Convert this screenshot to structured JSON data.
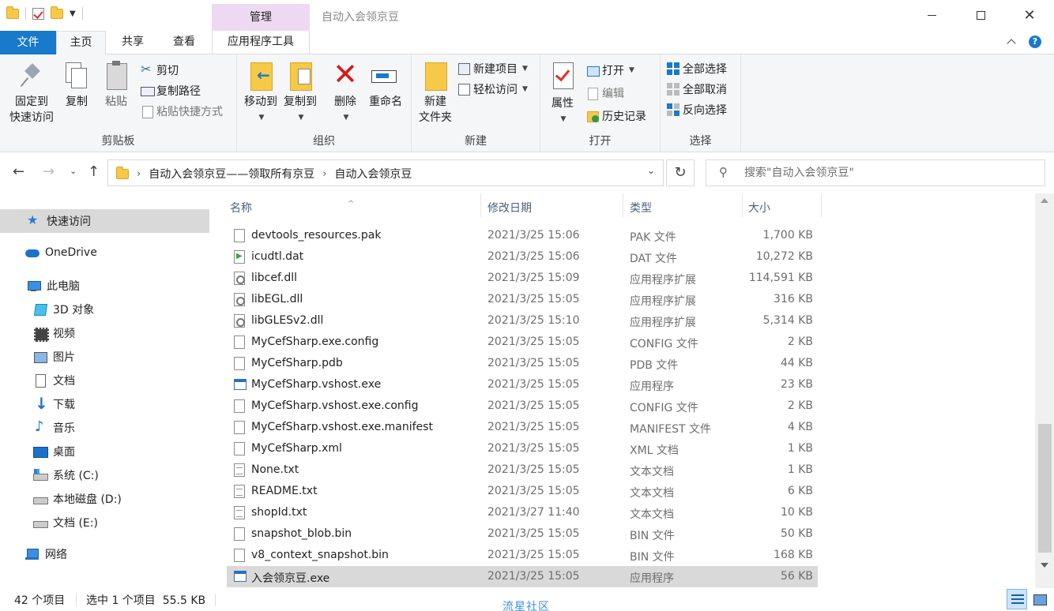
{
  "window": {
    "title": "自动入会领京豆",
    "manage_tab": "管理"
  },
  "ribbon_tabs": {
    "file": "文件",
    "home": "主页",
    "share": "共享",
    "view": "查看",
    "app_tools": "应用程序工具"
  },
  "ribbon": {
    "clipboard": {
      "label": "剪贴板",
      "pin": "固定到\n快速访问",
      "pin_line1": "固定到",
      "pin_line2": "快速访问",
      "copy": "复制",
      "paste": "粘贴",
      "cut": "剪切",
      "copy_path": "复制路径",
      "paste_shortcut": "粘贴快捷方式"
    },
    "organize": {
      "label": "组织",
      "move_to": "移动到",
      "copy_to": "复制到",
      "delete": "删除",
      "rename": "重命名"
    },
    "new": {
      "label": "新建",
      "new_folder_line1": "新建",
      "new_folder_line2": "文件夹",
      "new_item": "新建项目",
      "easy_access": "轻松访问"
    },
    "open": {
      "label": "打开",
      "properties": "属性",
      "open": "打开",
      "edit": "编辑",
      "history": "历史记录"
    },
    "select": {
      "label": "选择",
      "select_all": "全部选择",
      "select_none": "全部取消",
      "invert": "反向选择"
    }
  },
  "address": {
    "crumbs": [
      "自动入会领京豆——领取所有京豆",
      "自动入会领京豆"
    ]
  },
  "search": {
    "placeholder": "搜索\"自动入会领京豆\""
  },
  "nav_pane": {
    "quick_access": "快速访问",
    "onedrive": "OneDrive",
    "this_pc": "此电脑",
    "objects3d": "3D 对象",
    "videos": "视频",
    "pictures": "图片",
    "documents": "文档",
    "downloads": "下载",
    "music": "音乐",
    "desktop": "桌面",
    "drive_c": "系统 (C:)",
    "drive_d": "本地磁盘 (D:)",
    "drive_e": "文档 (E:)",
    "network": "网络"
  },
  "columns": {
    "name": "名称",
    "modified": "修改日期",
    "type": "类型",
    "size": "大小"
  },
  "files": [
    {
      "name": "devtools_resources.pak",
      "date": "2021/3/25 15:06",
      "type": "PAK 文件",
      "size": "1,700 KB",
      "icon": "blank-file-icon"
    },
    {
      "name": "icudtl.dat",
      "date": "2021/3/25 15:06",
      "type": "DAT 文件",
      "size": "10,272 KB",
      "icon": "media-file-icon"
    },
    {
      "name": "libcef.dll",
      "date": "2021/3/25 15:09",
      "type": "应用程序扩展",
      "size": "114,591 KB",
      "icon": "dll-file-icon"
    },
    {
      "name": "libEGL.dll",
      "date": "2021/3/25 15:05",
      "type": "应用程序扩展",
      "size": "316 KB",
      "icon": "dll-file-icon"
    },
    {
      "name": "libGLESv2.dll",
      "date": "2021/3/25 15:10",
      "type": "应用程序扩展",
      "size": "5,314 KB",
      "icon": "dll-file-icon"
    },
    {
      "name": "MyCefSharp.exe.config",
      "date": "2021/3/25 15:05",
      "type": "CONFIG 文件",
      "size": "2 KB",
      "icon": "blank-file-icon"
    },
    {
      "name": "MyCefSharp.pdb",
      "date": "2021/3/25 15:05",
      "type": "PDB 文件",
      "size": "44 KB",
      "icon": "blank-file-icon"
    },
    {
      "name": "MyCefSharp.vshost.exe",
      "date": "2021/3/25 15:05",
      "type": "应用程序",
      "size": "23 KB",
      "icon": "exe-file-icon"
    },
    {
      "name": "MyCefSharp.vshost.exe.config",
      "date": "2021/3/25 15:05",
      "type": "CONFIG 文件",
      "size": "2 KB",
      "icon": "blank-file-icon"
    },
    {
      "name": "MyCefSharp.vshost.exe.manifest",
      "date": "2021/3/25 15:05",
      "type": "MANIFEST 文件",
      "size": "4 KB",
      "icon": "blank-file-icon"
    },
    {
      "name": "MyCefSharp.xml",
      "date": "2021/3/25 15:05",
      "type": "XML 文档",
      "size": "1 KB",
      "icon": "blank-file-icon"
    },
    {
      "name": "None.txt",
      "date": "2021/3/25 15:05",
      "type": "文本文档",
      "size": "1 KB",
      "icon": "text-file-icon"
    },
    {
      "name": "README.txt",
      "date": "2021/3/25 15:05",
      "type": "文本文档",
      "size": "6 KB",
      "icon": "text-file-icon"
    },
    {
      "name": "shopId.txt",
      "date": "2021/3/27 11:40",
      "type": "文本文档",
      "size": "10 KB",
      "icon": "text-file-icon"
    },
    {
      "name": "snapshot_blob.bin",
      "date": "2021/3/25 15:05",
      "type": "BIN 文件",
      "size": "50 KB",
      "icon": "blank-file-icon"
    },
    {
      "name": "v8_context_snapshot.bin",
      "date": "2021/3/25 15:05",
      "type": "BIN 文件",
      "size": "168 KB",
      "icon": "blank-file-icon"
    },
    {
      "name": "入会领京豆.exe",
      "date": "2021/3/25 15:05",
      "type": "应用程序",
      "size": "56 KB",
      "icon": "exe-file-icon",
      "selected": true
    }
  ],
  "status": {
    "item_count": "42 个项目",
    "selected": "选中 1 个项目  55.5 KB",
    "watermark": "流星社区"
  },
  "colors": {
    "file_tab": "#1979ca",
    "manage_tab": "#eddaf2",
    "selection": "#d9d9d9"
  }
}
